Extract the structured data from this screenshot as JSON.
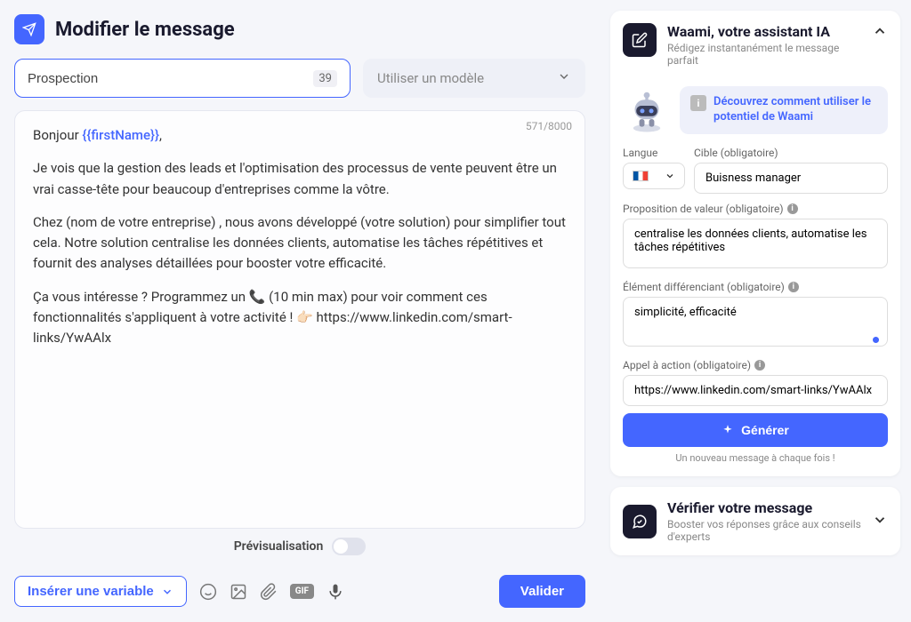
{
  "header": {
    "title": "Modifier le message"
  },
  "nameInput": {
    "value": "Prospection",
    "counter": "39"
  },
  "templateSelect": {
    "placeholder": "Utiliser un modèle"
  },
  "editor": {
    "counter": "571/8000",
    "greeting_pre": "Bonjour ",
    "greeting_var": "{{firstName}}",
    "greeting_post": ",",
    "para1": "Je vois que la gestion des leads et l'optimisation des processus de vente peuvent être un vrai casse-tête pour beaucoup d'entreprises comme la vôtre.",
    "para2": "Chez (nom de votre entreprise) , nous avons développé (votre solution) pour simplifier tout cela. Notre solution centralise les données clients, automatise les tâches répétitives et fournit des analyses détaillées pour booster votre efficacité.",
    "para3": "Ça vous intéresse ? Programmez un 📞 (10 min max) pour voir comment ces fonctionnalités s'appliquent à votre activité ! 👉🏻 https://www.linkedin.com/smart-links/YwAAlx"
  },
  "preview": {
    "label": "Prévisualisation"
  },
  "bottom": {
    "insert_variable": "Insérer une variable",
    "gif": "GIF",
    "validate": "Valider"
  },
  "waami": {
    "title": "Waami, votre assistant IA",
    "subtitle": "Rédigez instantanément le message parfait",
    "tip": "Découvrez comment utiliser le potentiel de Waami",
    "labels": {
      "langue": "Langue",
      "cible": "Cible (obligatoire)",
      "proposition": "Proposition de valeur (obligatoire)",
      "differenciant": "Élément différenciant (obligatoire)",
      "cta": "Appel à action (obligatoire)"
    },
    "values": {
      "cible": "Buisness manager",
      "proposition": "centralise les données clients, automatise les tâches répétitives",
      "differenciant": "simplicité, efficacité",
      "cta": "https://www.linkedin.com/smart-links/YwAAlx"
    },
    "generate": "Générer",
    "note": "Un nouveau message à chaque fois !"
  },
  "verify": {
    "title": "Vérifier votre message",
    "subtitle": "Booster vos réponses grâce aux conseils d'experts"
  }
}
